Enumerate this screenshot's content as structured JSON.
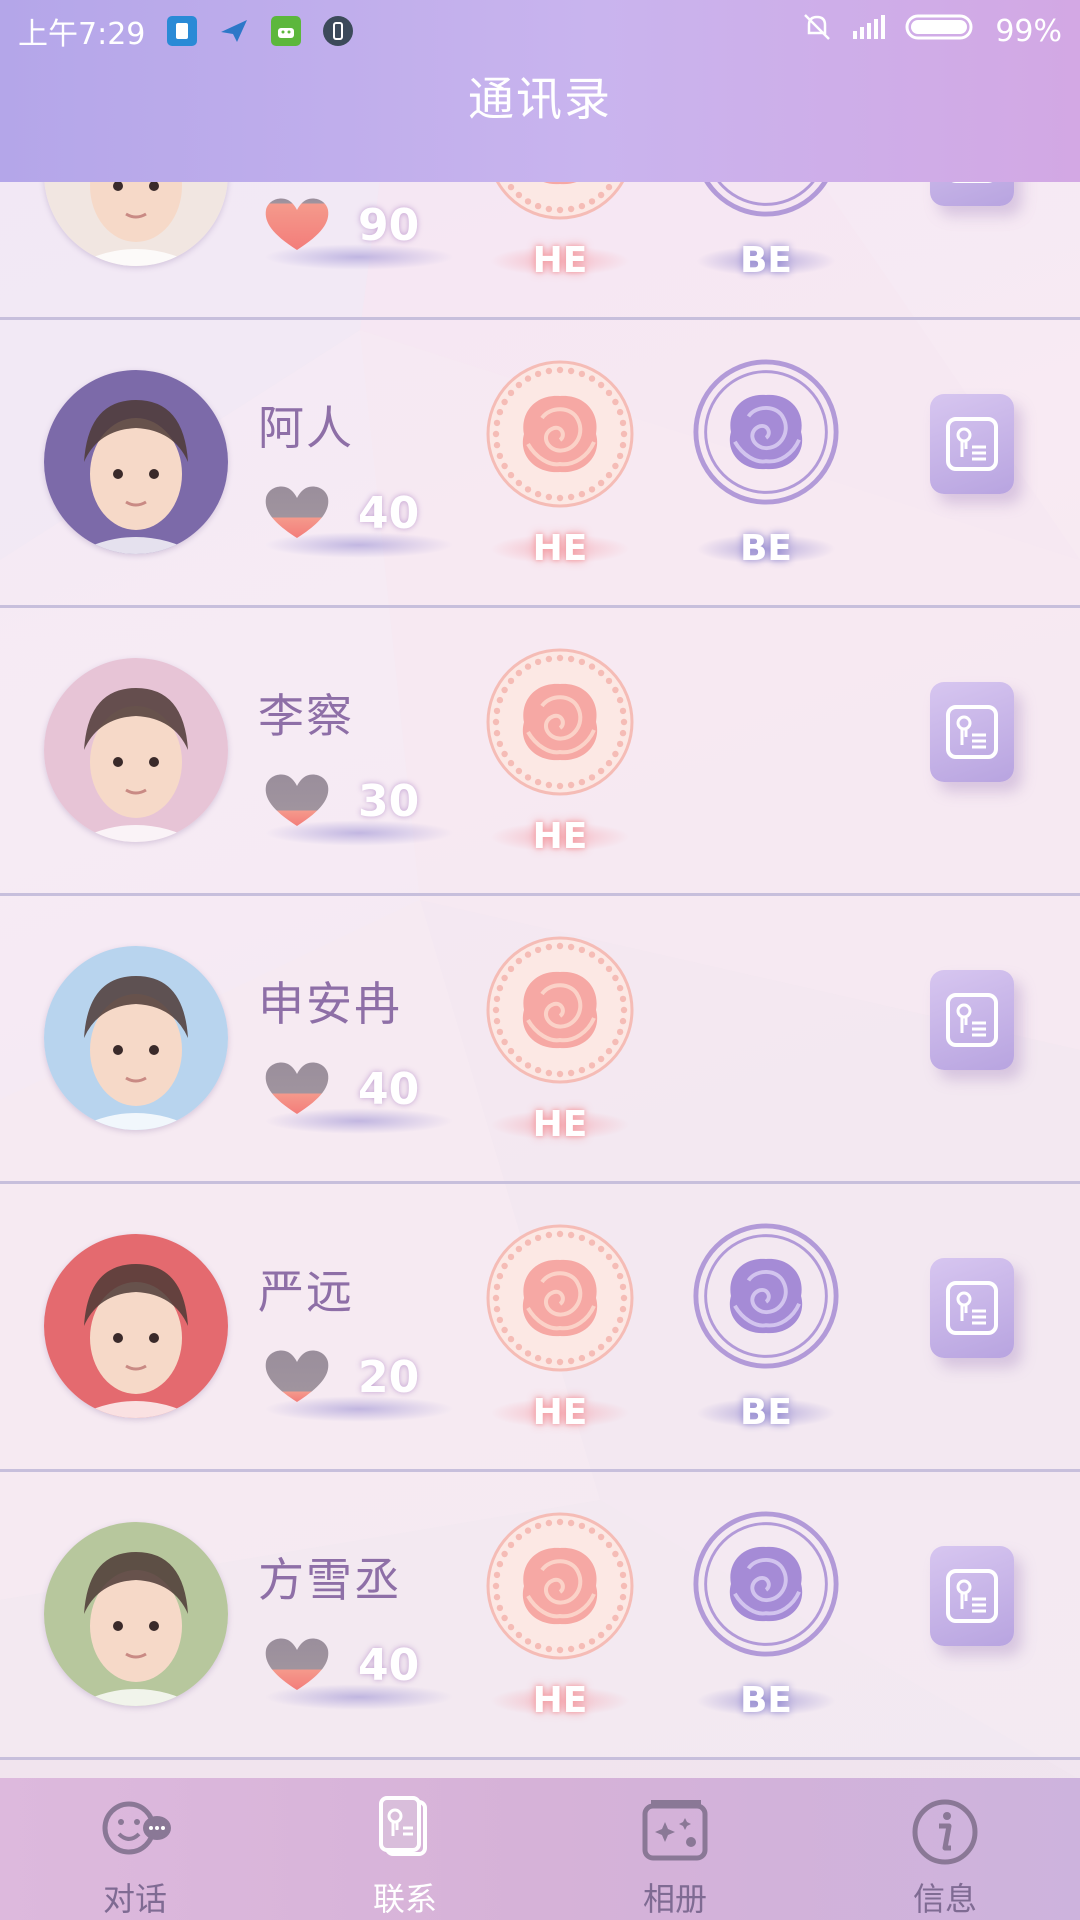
{
  "status_bar": {
    "time": "上午7:29",
    "battery": "99%"
  },
  "header": {
    "title": "通讯录"
  },
  "contacts": [
    {
      "name": "",
      "affection": "90",
      "he_label": "HE",
      "be_label": "BE",
      "has_be": true,
      "avatar_color": "#f1e6e1"
    },
    {
      "name": "阿人",
      "affection": "40",
      "he_label": "HE",
      "be_label": "BE",
      "has_be": true,
      "avatar_color": "#7c6aa9"
    },
    {
      "name": "李察",
      "affection": "30",
      "he_label": "HE",
      "be_label": "",
      "has_be": false,
      "avatar_color": "#e7c4d6"
    },
    {
      "name": "申安冉",
      "affection": "40",
      "he_label": "HE",
      "be_label": "",
      "has_be": false,
      "avatar_color": "#b8d4ee"
    },
    {
      "name": "严远",
      "affection": "20",
      "he_label": "HE",
      "be_label": "BE",
      "has_be": true,
      "avatar_color": "#e46a6f"
    },
    {
      "name": "方雪丞",
      "affection": "40",
      "he_label": "HE",
      "be_label": "BE",
      "has_be": true,
      "avatar_color": "#b7c79d"
    }
  ],
  "bottom_nav": [
    {
      "label": "对话",
      "icon": "chat-bubble-icon"
    },
    {
      "label": "联系",
      "icon": "contact-card-icon",
      "active": true
    },
    {
      "label": "相册",
      "icon": "album-icon"
    },
    {
      "label": "信息",
      "icon": "info-icon"
    }
  ],
  "colors": {
    "header_start": "#b4a6e9",
    "header_end": "#d3a8e4",
    "he_rose": "#f6a8a4",
    "be_rose": "#a58bd6",
    "card": "#c6b4e8"
  }
}
